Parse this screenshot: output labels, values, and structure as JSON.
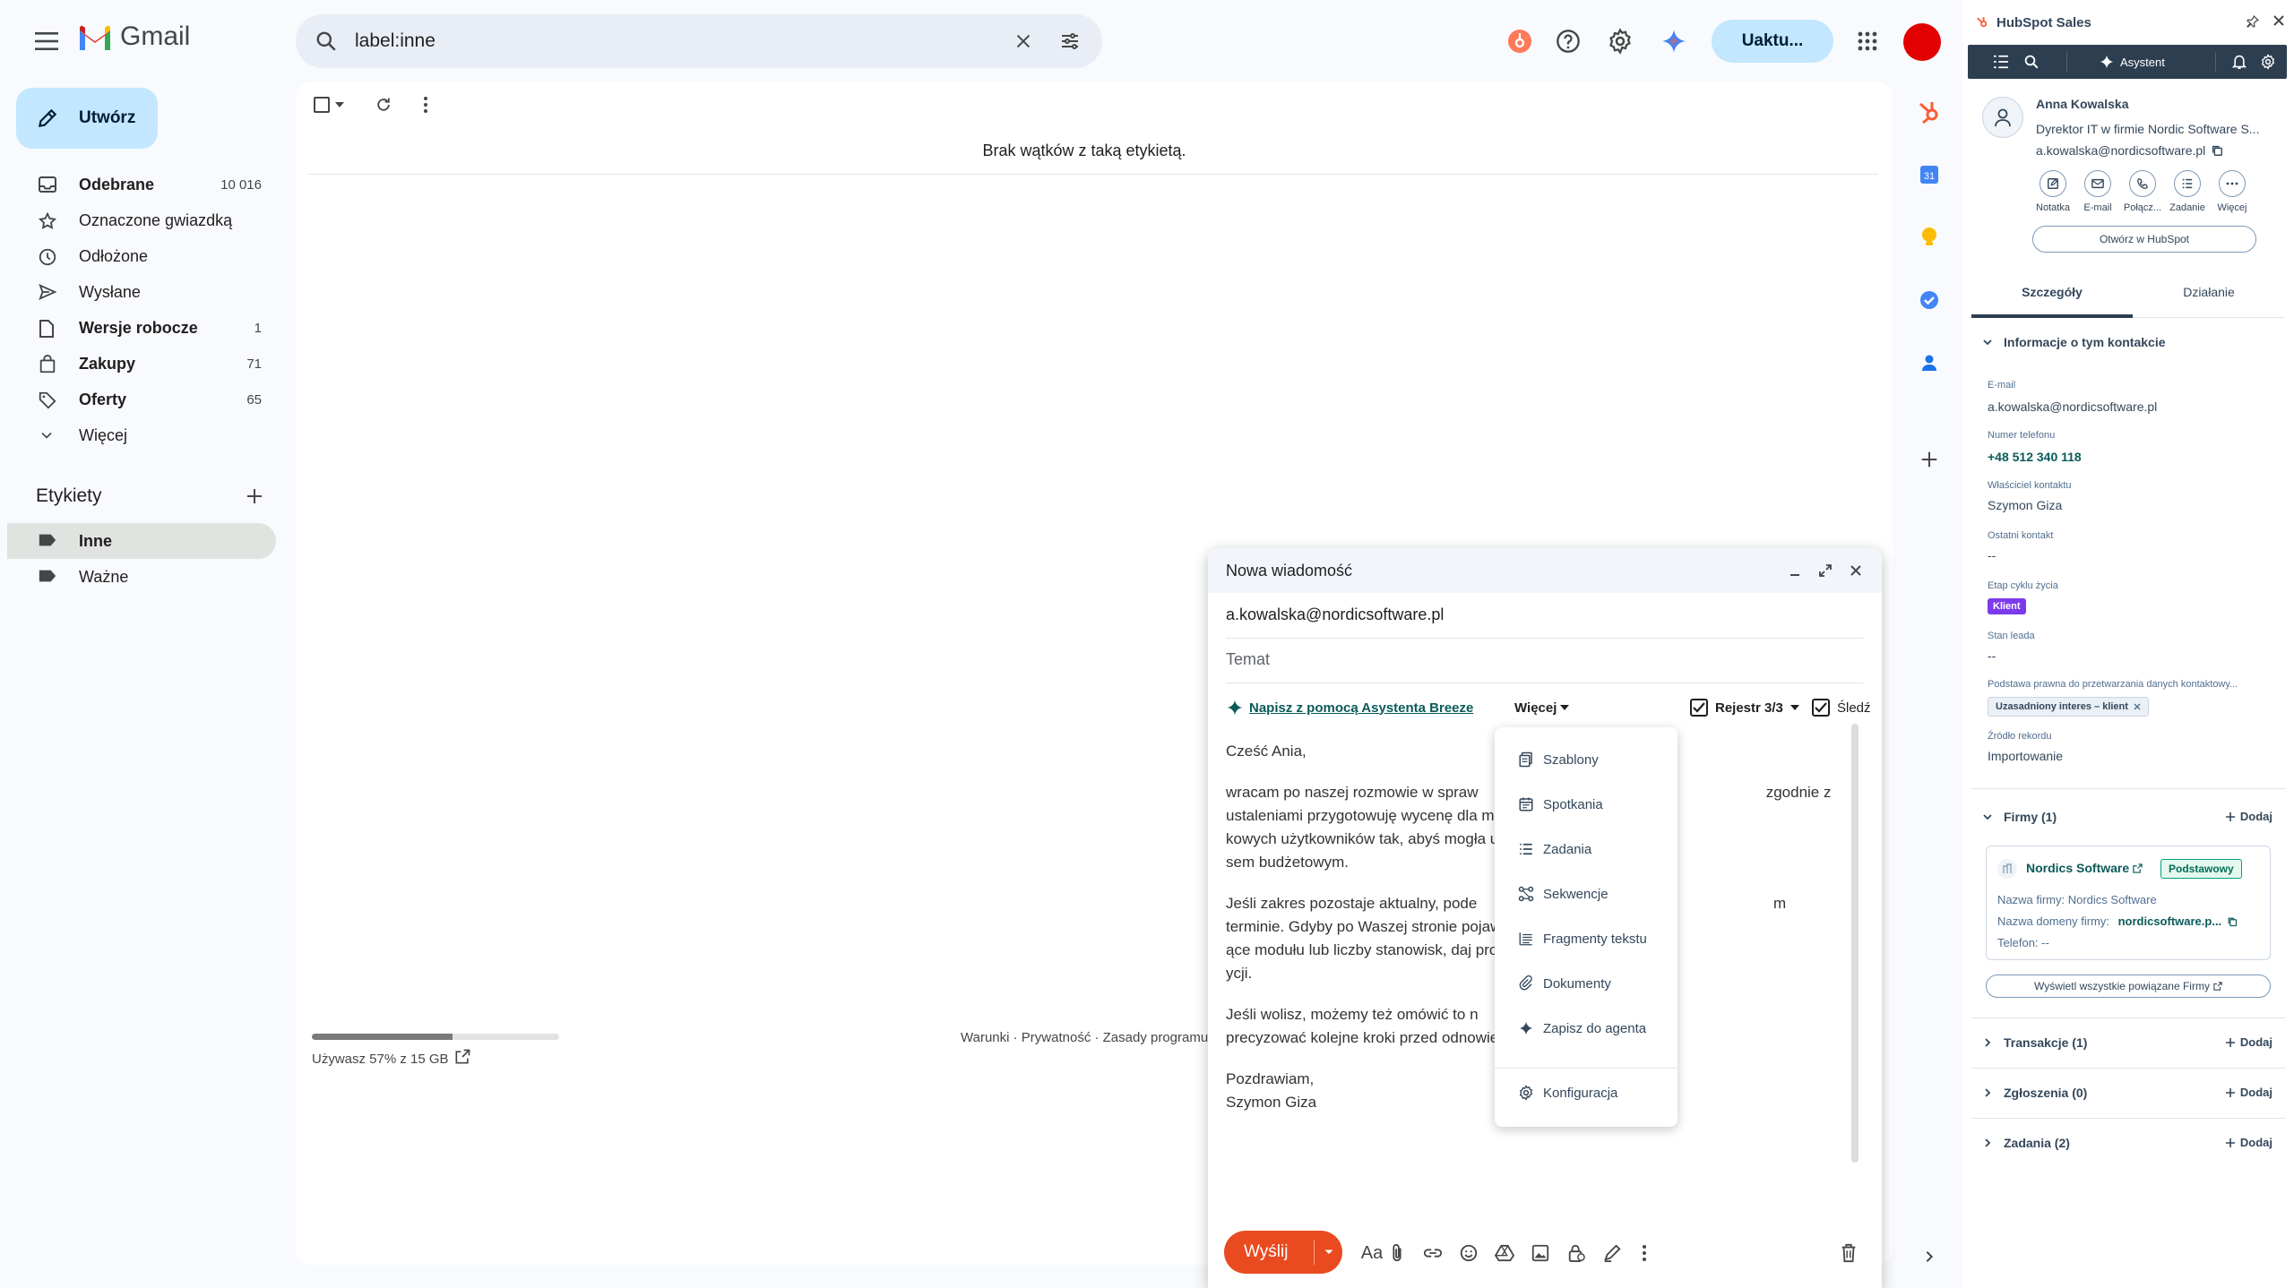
{
  "gmail": {
    "logo_text": "Gmail",
    "search": {
      "value": "label:inne"
    },
    "upgrade_label": "Uaktu...",
    "compose_label": "Utwórz",
    "nav": [
      {
        "label": "Odebrane",
        "count": "10 016",
        "icon": "inbox-icon"
      },
      {
        "label": "Oznaczone gwiazdką",
        "count": "",
        "icon": "star-icon"
      },
      {
        "label": "Odłożone",
        "count": "",
        "icon": "clock-icon"
      },
      {
        "label": "Wysłane",
        "count": "",
        "icon": "send-icon"
      },
      {
        "label": "Wersje robocze",
        "count": "1",
        "icon": "draft-icon"
      },
      {
        "label": "Zakupy",
        "count": "71",
        "icon": "shopping-bag-icon"
      },
      {
        "label": "Oferty",
        "count": "65",
        "icon": "tag-icon"
      },
      {
        "label": "Więcej",
        "count": "",
        "icon": "chevron-down-icon"
      }
    ],
    "labels_title": "Etykiety",
    "labels": [
      {
        "label": "Inne"
      },
      {
        "label": "Ważne"
      }
    ],
    "empty_message": "Brak wątków z taką etykietą.",
    "storage": {
      "text": "Używasz 57% z 15 GB",
      "fraction": 0.57
    },
    "footer": "Warunki · Prywatność · Zasady programu"
  },
  "compose": {
    "title": "Nowa wiadomość",
    "to": "a.kowalska@nordicsoftware.pl",
    "subject_placeholder": "Temat",
    "ai_link": "Napisz z pomocą Asystenta Breeze",
    "more_label": "Więcej",
    "log_label": "Rejestr 3/3",
    "track_label": "Śledź",
    "body": {
      "greeting": "Cześć Ania,",
      "p1": "wracam po naszej rozmowie w spraw                                                                    zgodnie z ustaleniami przygotowuję wycenę dla modułu rap                                                            kowych użytkowników tak, abyś mogła uwzględnić temat pr                                                          sem budżetowym.",
      "p2": "Jeśli zakres pozostaje aktualny, pode                                                                      m terminie. Gdyby po Waszej stronie pojawiły się jeszcze ja                                                       ące modułu lub liczby stanowisk, daj proszę znać — uwzględ                                                        ycji.",
      "p3": "Jeśli wolisz, możemy też omówić to n                                                                          precyzować kolejne kroki przed odnowieniem obecnej lice",
      "closing": "Pozdrawiam,",
      "signature": "Szymon Giza"
    },
    "send_label": "Wyślij"
  },
  "more_menu": [
    {
      "label": "Szablony",
      "icon": "template-icon"
    },
    {
      "label": "Spotkania",
      "icon": "calendar-icon"
    },
    {
      "label": "Zadania",
      "icon": "tasks-icon"
    },
    {
      "label": "Sekwencje",
      "icon": "sequence-icon"
    },
    {
      "label": "Fragmenty tekstu",
      "icon": "snippet-icon"
    },
    {
      "label": "Dokumenty",
      "icon": "document-icon"
    },
    {
      "label": "Zapisz do agenta",
      "icon": "sparkle-icon"
    },
    {
      "label": "Konfiguracja",
      "icon": "gear-icon"
    }
  ],
  "hubspot": {
    "title": "HubSpot Sales",
    "assistant_label": "Asystent",
    "contact": {
      "name": "Anna Kowalska",
      "title": "Dyrektor IT w firmie Nordic Software S...",
      "email": "a.kowalska@nordicsoftware.pl"
    },
    "actions": [
      {
        "label": "Notatka",
        "icon": "note-icon"
      },
      {
        "label": "E-mail",
        "icon": "email-icon"
      },
      {
        "label": "Połącz...",
        "icon": "phone-icon"
      },
      {
        "label": "Zadanie",
        "icon": "task-icon"
      },
      {
        "label": "Więcej",
        "icon": "more-icon"
      }
    ],
    "open_button": "Otwórz w HubSpot",
    "tabs": [
      "Szczegóły",
      "Działanie"
    ],
    "about_section": "Informacje o tym kontakcie",
    "fields": {
      "email_label": "E-mail",
      "email_value": "a.kowalska@nordicsoftware.pl",
      "phone_label": "Numer telefonu",
      "phone_value": "+48 512 340 118",
      "owner_label": "Właściciel kontaktu",
      "owner_value": "Szymon Giza",
      "last_contact_label": "Ostatni kontakt",
      "last_contact_value": "--",
      "stage_label": "Etap cyklu życia",
      "stage_value": "Klient",
      "lead_status_label": "Stan leada",
      "lead_status_value": "--",
      "legal_label": "Podstawa prawna do przetwarzania danych kontaktowy...",
      "legal_value": "Uzasadniony interes – klient",
      "source_label": "Źródło rekordu",
      "source_value": "Importowanie"
    },
    "companies_section": "Firmy (1)",
    "add_label": "Dodaj",
    "company": {
      "name": "Nordics Software",
      "badge": "Podstawowy",
      "name_line": "Nazwa firmy: Nordics Software",
      "domain_prefix": "Nazwa domeny firmy: ",
      "domain_value": "nordicsoftware.p...",
      "phone_line": "Telefon: --"
    },
    "view_all": "Wyświetl wszystkie powiązane Firmy",
    "deals_section": "Transakcje (1)",
    "tickets_section": "Zgłoszenia (0)",
    "tasks_section": "Zadania (2)"
  },
  "colors": {
    "compose_button": "#c2e7ff",
    "send_button": "#ea4a1f",
    "lifecycle_badge": "#7c3aed",
    "hubspot_toolbar": "#2d3e50",
    "avatar": "#e30000"
  }
}
